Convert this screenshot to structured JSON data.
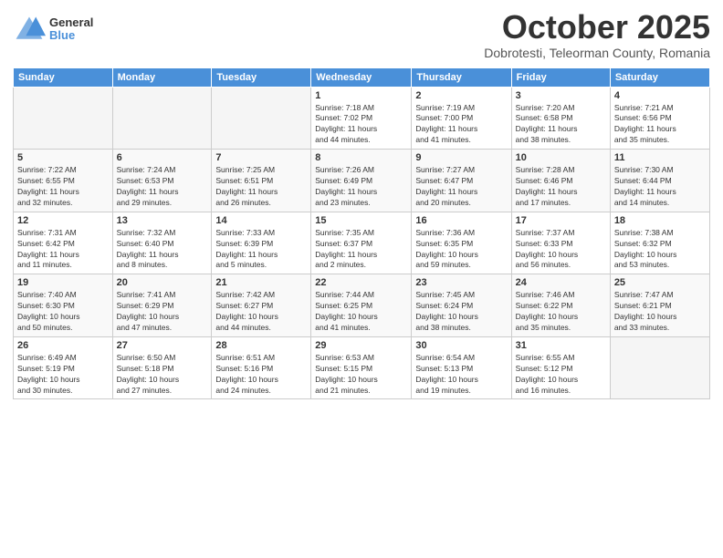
{
  "logo": {
    "general": "General",
    "blue": "Blue"
  },
  "header": {
    "month": "October 2025",
    "location": "Dobrotesti, Teleorman County, Romania"
  },
  "days_of_week": [
    "Sunday",
    "Monday",
    "Tuesday",
    "Wednesday",
    "Thursday",
    "Friday",
    "Saturday"
  ],
  "weeks": [
    [
      {
        "day": "",
        "info": ""
      },
      {
        "day": "",
        "info": ""
      },
      {
        "day": "",
        "info": ""
      },
      {
        "day": "1",
        "info": "Sunrise: 7:18 AM\nSunset: 7:02 PM\nDaylight: 11 hours\nand 44 minutes."
      },
      {
        "day": "2",
        "info": "Sunrise: 7:19 AM\nSunset: 7:00 PM\nDaylight: 11 hours\nand 41 minutes."
      },
      {
        "day": "3",
        "info": "Sunrise: 7:20 AM\nSunset: 6:58 PM\nDaylight: 11 hours\nand 38 minutes."
      },
      {
        "day": "4",
        "info": "Sunrise: 7:21 AM\nSunset: 6:56 PM\nDaylight: 11 hours\nand 35 minutes."
      }
    ],
    [
      {
        "day": "5",
        "info": "Sunrise: 7:22 AM\nSunset: 6:55 PM\nDaylight: 11 hours\nand 32 minutes."
      },
      {
        "day": "6",
        "info": "Sunrise: 7:24 AM\nSunset: 6:53 PM\nDaylight: 11 hours\nand 29 minutes."
      },
      {
        "day": "7",
        "info": "Sunrise: 7:25 AM\nSunset: 6:51 PM\nDaylight: 11 hours\nand 26 minutes."
      },
      {
        "day": "8",
        "info": "Sunrise: 7:26 AM\nSunset: 6:49 PM\nDaylight: 11 hours\nand 23 minutes."
      },
      {
        "day": "9",
        "info": "Sunrise: 7:27 AM\nSunset: 6:47 PM\nDaylight: 11 hours\nand 20 minutes."
      },
      {
        "day": "10",
        "info": "Sunrise: 7:28 AM\nSunset: 6:46 PM\nDaylight: 11 hours\nand 17 minutes."
      },
      {
        "day": "11",
        "info": "Sunrise: 7:30 AM\nSunset: 6:44 PM\nDaylight: 11 hours\nand 14 minutes."
      }
    ],
    [
      {
        "day": "12",
        "info": "Sunrise: 7:31 AM\nSunset: 6:42 PM\nDaylight: 11 hours\nand 11 minutes."
      },
      {
        "day": "13",
        "info": "Sunrise: 7:32 AM\nSunset: 6:40 PM\nDaylight: 11 hours\nand 8 minutes."
      },
      {
        "day": "14",
        "info": "Sunrise: 7:33 AM\nSunset: 6:39 PM\nDaylight: 11 hours\nand 5 minutes."
      },
      {
        "day": "15",
        "info": "Sunrise: 7:35 AM\nSunset: 6:37 PM\nDaylight: 11 hours\nand 2 minutes."
      },
      {
        "day": "16",
        "info": "Sunrise: 7:36 AM\nSunset: 6:35 PM\nDaylight: 10 hours\nand 59 minutes."
      },
      {
        "day": "17",
        "info": "Sunrise: 7:37 AM\nSunset: 6:33 PM\nDaylight: 10 hours\nand 56 minutes."
      },
      {
        "day": "18",
        "info": "Sunrise: 7:38 AM\nSunset: 6:32 PM\nDaylight: 10 hours\nand 53 minutes."
      }
    ],
    [
      {
        "day": "19",
        "info": "Sunrise: 7:40 AM\nSunset: 6:30 PM\nDaylight: 10 hours\nand 50 minutes."
      },
      {
        "day": "20",
        "info": "Sunrise: 7:41 AM\nSunset: 6:29 PM\nDaylight: 10 hours\nand 47 minutes."
      },
      {
        "day": "21",
        "info": "Sunrise: 7:42 AM\nSunset: 6:27 PM\nDaylight: 10 hours\nand 44 minutes."
      },
      {
        "day": "22",
        "info": "Sunrise: 7:44 AM\nSunset: 6:25 PM\nDaylight: 10 hours\nand 41 minutes."
      },
      {
        "day": "23",
        "info": "Sunrise: 7:45 AM\nSunset: 6:24 PM\nDaylight: 10 hours\nand 38 minutes."
      },
      {
        "day": "24",
        "info": "Sunrise: 7:46 AM\nSunset: 6:22 PM\nDaylight: 10 hours\nand 35 minutes."
      },
      {
        "day": "25",
        "info": "Sunrise: 7:47 AM\nSunset: 6:21 PM\nDaylight: 10 hours\nand 33 minutes."
      }
    ],
    [
      {
        "day": "26",
        "info": "Sunrise: 6:49 AM\nSunset: 5:19 PM\nDaylight: 10 hours\nand 30 minutes."
      },
      {
        "day": "27",
        "info": "Sunrise: 6:50 AM\nSunset: 5:18 PM\nDaylight: 10 hours\nand 27 minutes."
      },
      {
        "day": "28",
        "info": "Sunrise: 6:51 AM\nSunset: 5:16 PM\nDaylight: 10 hours\nand 24 minutes."
      },
      {
        "day": "29",
        "info": "Sunrise: 6:53 AM\nSunset: 5:15 PM\nDaylight: 10 hours\nand 21 minutes."
      },
      {
        "day": "30",
        "info": "Sunrise: 6:54 AM\nSunset: 5:13 PM\nDaylight: 10 hours\nand 19 minutes."
      },
      {
        "day": "31",
        "info": "Sunrise: 6:55 AM\nSunset: 5:12 PM\nDaylight: 10 hours\nand 16 minutes."
      },
      {
        "day": "",
        "info": ""
      }
    ]
  ]
}
